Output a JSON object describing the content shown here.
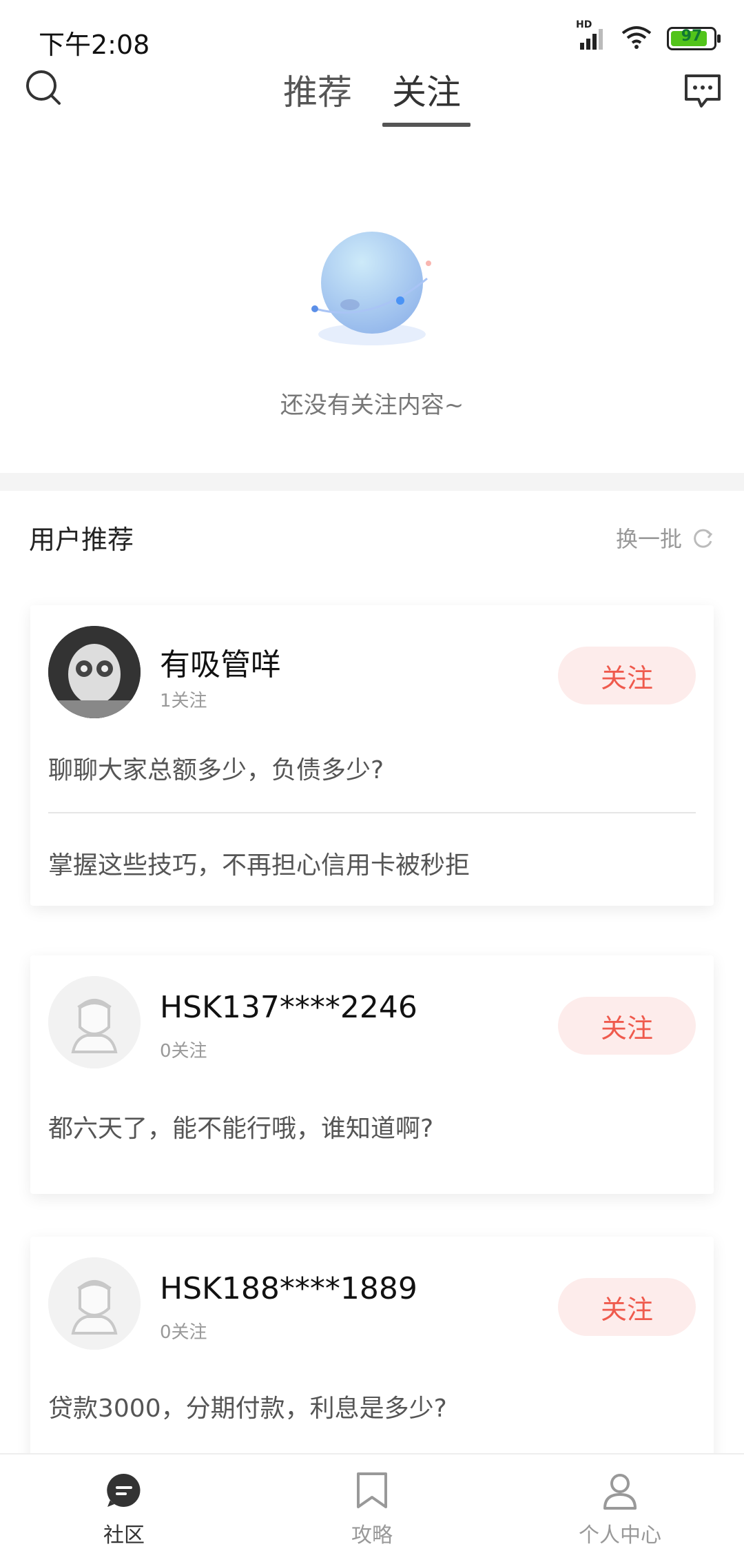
{
  "status_bar": {
    "time": "下午2:08",
    "network": "HD",
    "battery_percent": "97",
    "battery_level": 0.97
  },
  "header": {
    "tabs": [
      {
        "label": "推荐",
        "active": false
      },
      {
        "label": "关注",
        "active": true
      }
    ],
    "icons": {
      "search": "search-icon",
      "message": "message-icon"
    }
  },
  "empty_state": {
    "message": "还没有关注内容~"
  },
  "recommend": {
    "title": "用户推荐",
    "refresh_label": "换一批"
  },
  "cards": [
    {
      "name": "有吸管咩",
      "follow_count": "1关注",
      "follow_label": "关注",
      "posts": [
        "聊聊大家总额多少，负债多少?",
        "掌握这些技巧，不再担心信用卡被秒拒"
      ]
    },
    {
      "name": "HSK137****2246",
      "follow_count": "0关注",
      "follow_label": "关注",
      "posts": [
        "都六天了，能不能行哦，谁知道啊?"
      ]
    },
    {
      "name": "HSK188****1889",
      "follow_count": "0关注",
      "follow_label": "关注",
      "posts": [
        "贷款3000，分期付款，利息是多少?"
      ]
    }
  ],
  "bottom_nav": [
    {
      "label": "社区",
      "icon": "community-icon",
      "active": true
    },
    {
      "label": "攻略",
      "icon": "bookmark-icon",
      "active": false
    },
    {
      "label": "个人中心",
      "icon": "person-icon",
      "active": false
    }
  ],
  "colors": {
    "accent": "#ef5a4d",
    "follow_bg": "#fdeceb",
    "battery": "#52c41a"
  }
}
